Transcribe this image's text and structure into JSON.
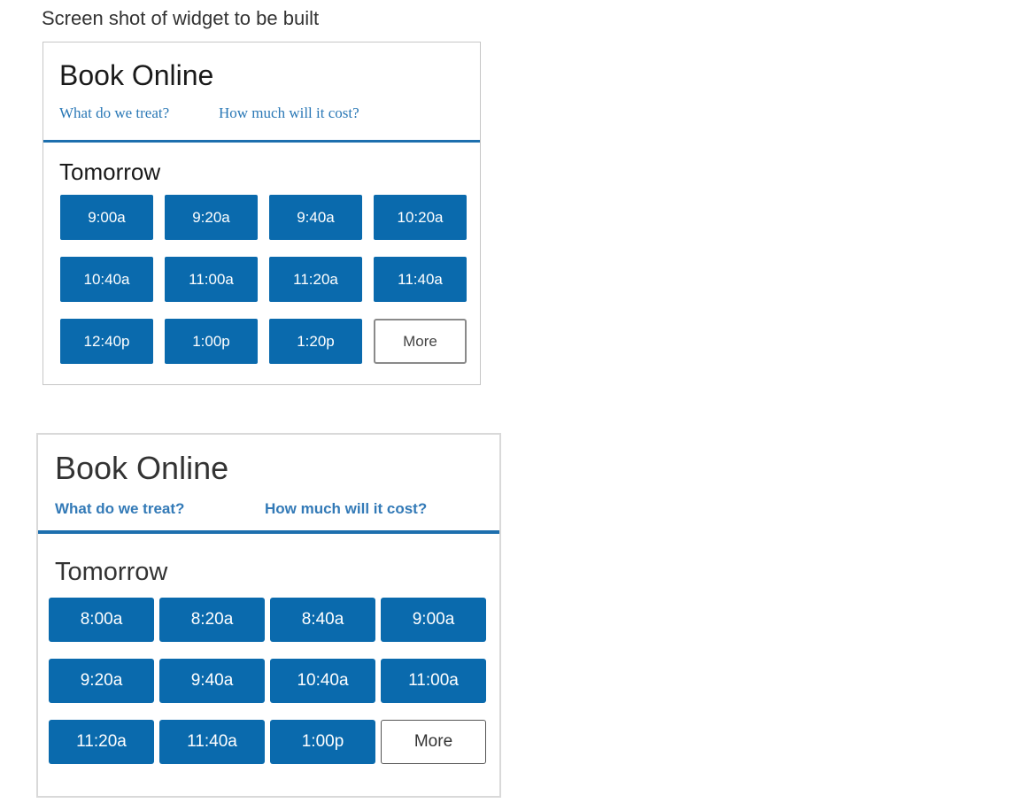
{
  "caption": "Screen shot of widget to be built",
  "mockup_widget": {
    "title": "Book Online",
    "link_treat": "What do we treat?",
    "link_cost": "How much will it cost?",
    "day_label": "Tomorrow",
    "slots": [
      "9:00a",
      "9:20a",
      "9:40a",
      "10:20a",
      "10:40a",
      "11:00a",
      "11:20a",
      "11:40a",
      "12:40p",
      "1:00p",
      "1:20p"
    ],
    "more_label": "More"
  },
  "built_widget": {
    "title": "Book Online",
    "link_treat": "What do we treat?",
    "link_cost": "How much will it cost?",
    "day_label": "Tomorrow",
    "slots": [
      "8:00a",
      "8:20a",
      "8:40a",
      "9:00a",
      "9:20a",
      "9:40a",
      "10:40a",
      "11:00a",
      "11:20a",
      "11:40a",
      "1:00p"
    ],
    "more_label": "More"
  },
  "colors": {
    "slot_background": "#0a6aad",
    "divider": "#1d6fae",
    "link_mockup": "#2a78b6",
    "link_built": "#337ab7"
  }
}
